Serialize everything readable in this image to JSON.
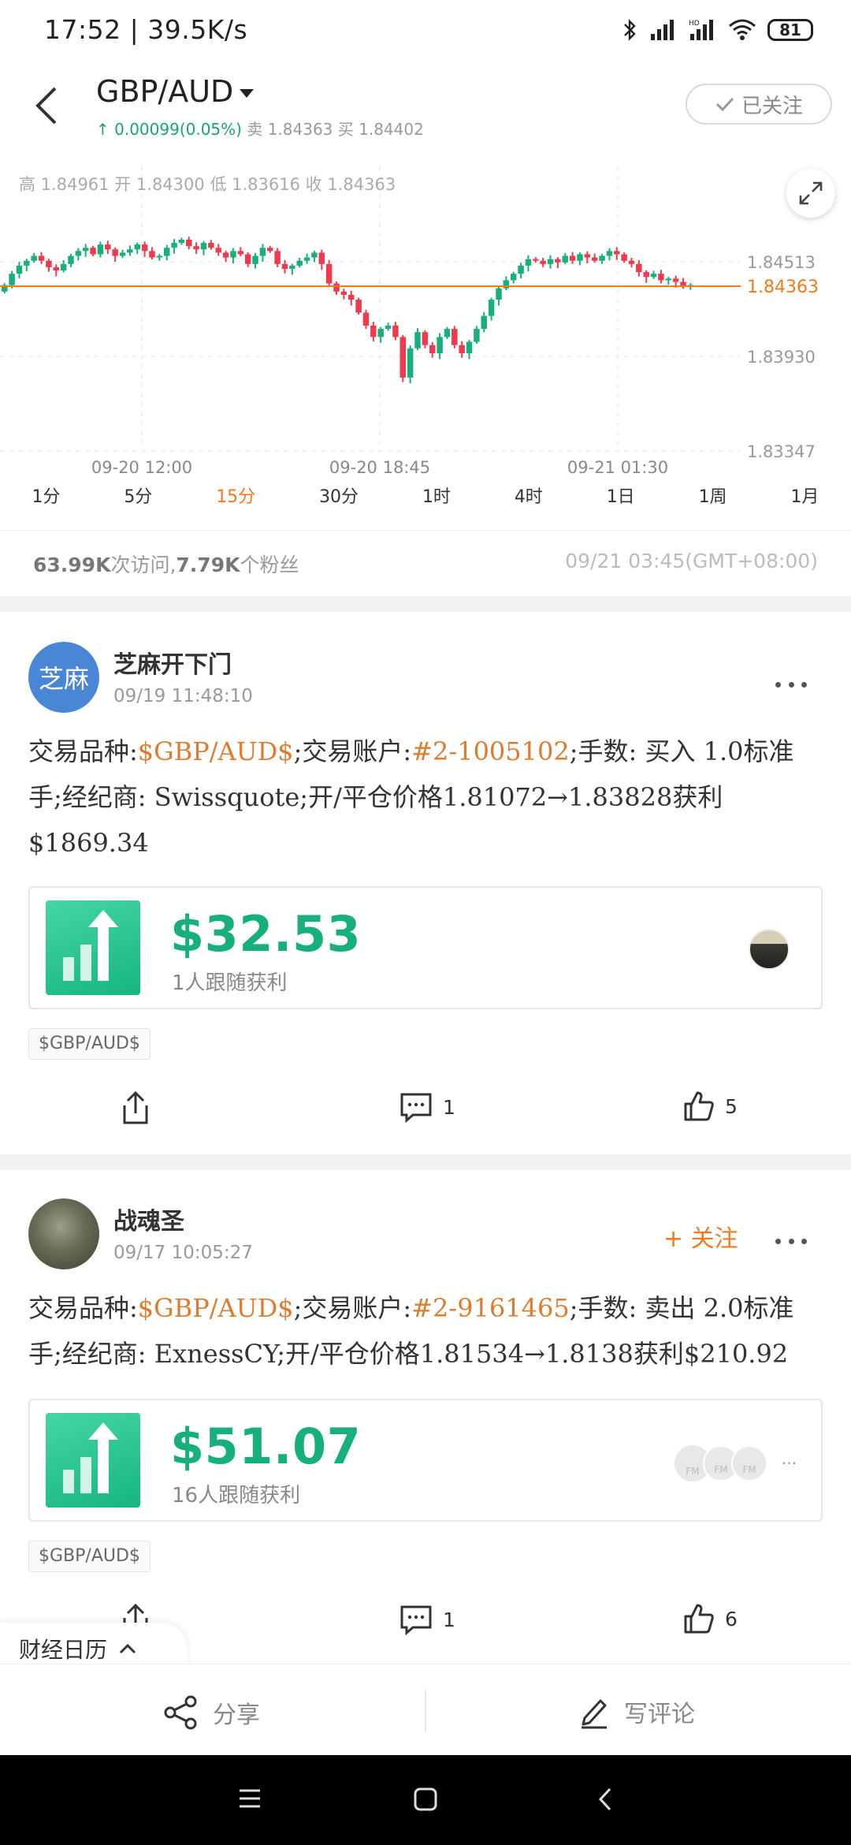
{
  "status_bar": {
    "time": "17:52",
    "net_speed": "39.5K/s",
    "battery": "81"
  },
  "header": {
    "symbol": "GBP/AUD",
    "change": "↑ 0.00099(0.05%)",
    "sell_label": "卖",
    "sell": "1.84363",
    "buy_label": "买",
    "buy": "1.84402",
    "follow_label": "已关注"
  },
  "chart": {
    "ohlc": {
      "high_label": "高",
      "high": "1.84961",
      "open_label": "开",
      "open": "1.84300",
      "low_label": "低",
      "low": "1.83616",
      "close_label": "收",
      "close": "1.84363"
    },
    "current_price": "1.84363",
    "colors": {
      "up": "#17b07a",
      "down": "#ee3a4d",
      "current_line": "#f07a1e"
    }
  },
  "chart_data": {
    "type": "candlestick",
    "y_ticks": [
      "1.84513",
      "1.83930",
      "1.83347"
    ],
    "x_ticks": [
      "09-20 12:00",
      "09-20 18:45",
      "09-21 01:30"
    ],
    "ylim": [
      1.83347,
      1.84961
    ],
    "current": 1.84363,
    "close_series": [
      1.8437,
      1.8444,
      1.8449,
      1.8452,
      1.8455,
      1.8452,
      1.8448,
      1.8446,
      1.845,
      1.8455,
      1.8458,
      1.846,
      1.8456,
      1.8462,
      1.8459,
      1.8455,
      1.8457,
      1.8459,
      1.8462,
      1.8458,
      1.8454,
      1.8455,
      1.846,
      1.8463,
      1.8465,
      1.8461,
      1.8459,
      1.8463,
      1.846,
      1.8457,
      1.8454,
      1.8458,
      1.8456,
      1.845,
      1.8455,
      1.846,
      1.8458,
      1.845,
      1.8447,
      1.8449,
      1.8452,
      1.8454,
      1.8457,
      1.845,
      1.8438,
      1.8433,
      1.8431,
      1.8428,
      1.842,
      1.8412,
      1.8405,
      1.841,
      1.8412,
      1.8405,
      1.838,
      1.8398,
      1.8408,
      1.84,
      1.8395,
      1.8405,
      1.841,
      1.84,
      1.8395,
      1.8402,
      1.841,
      1.8418,
      1.8428,
      1.8435,
      1.844,
      1.8444,
      1.8449,
      1.8453,
      1.8452,
      1.845,
      1.8453,
      1.8451,
      1.8455,
      1.8452,
      1.8456,
      1.8454,
      1.8452,
      1.8455,
      1.8458,
      1.8456,
      1.8452,
      1.845,
      1.8445,
      1.8442,
      1.8444,
      1.844,
      1.8441,
      1.8439,
      1.8436,
      1.8437
    ]
  },
  "timeframes": [
    "1分",
    "5分",
    "15分",
    "30分",
    "1时",
    "4时",
    "1日",
    "1周",
    "1月"
  ],
  "active_timeframe": "15分",
  "stats": {
    "visits": "63.99K",
    "visits_label": "次访问,",
    "fans": "7.79K",
    "fans_label": "个粉丝",
    "datetime": "09/21 03:45(GMT+08:00)"
  },
  "posts": [
    {
      "avatar_text": "芝麻",
      "username": "芝麻开下门",
      "time": "09/19 11:48:10",
      "t1": "交易品种:",
      "symbol": "$GBP/AUD$",
      "t2": ";交易账户:",
      "account": "#2-1005102",
      "t3": ";手数: 买入 1.0标准手;经纪商: Swissquote;开/平仓价格1.81072→1.83828获利$1869.34",
      "profit": "$32.53",
      "followers_text": "1人跟随获利",
      "tag": "$GBP/AUD$",
      "comments": "1",
      "likes": "5"
    },
    {
      "username": "战魂圣",
      "time": "09/17 10:05:27",
      "follow_label": "+ 关注",
      "t1": "交易品种:",
      "symbol": "$GBP/AUD$",
      "t2": ";交易账户:",
      "account": "#2-9161465",
      "t3": ";手数: 卖出 2.0标准手;经纪商: ExnessCY;开/平仓价格1.81534→1.8138获利$210.92",
      "profit": "$51.07",
      "followers_text": "16人跟随获利",
      "follower_badges": [
        "FM",
        "FM",
        "FM"
      ],
      "tag": "$GBP/AUD$",
      "comments": "1",
      "likes": "6"
    }
  ],
  "calendar_tab": "财经日历",
  "bottom_bar": {
    "share": "分享",
    "comment": "写评论"
  },
  "icons": [
    "bluetooth-icon",
    "signal-icon",
    "wifi-icon",
    "battery-icon",
    "back-arrow-icon",
    "dropdown-caret-icon",
    "check-icon",
    "expand-icon",
    "more-icon",
    "share-icon",
    "comment-icon",
    "like-icon",
    "chevron-up-icon",
    "menu-icon",
    "home-icon",
    "back-nav-icon"
  ]
}
